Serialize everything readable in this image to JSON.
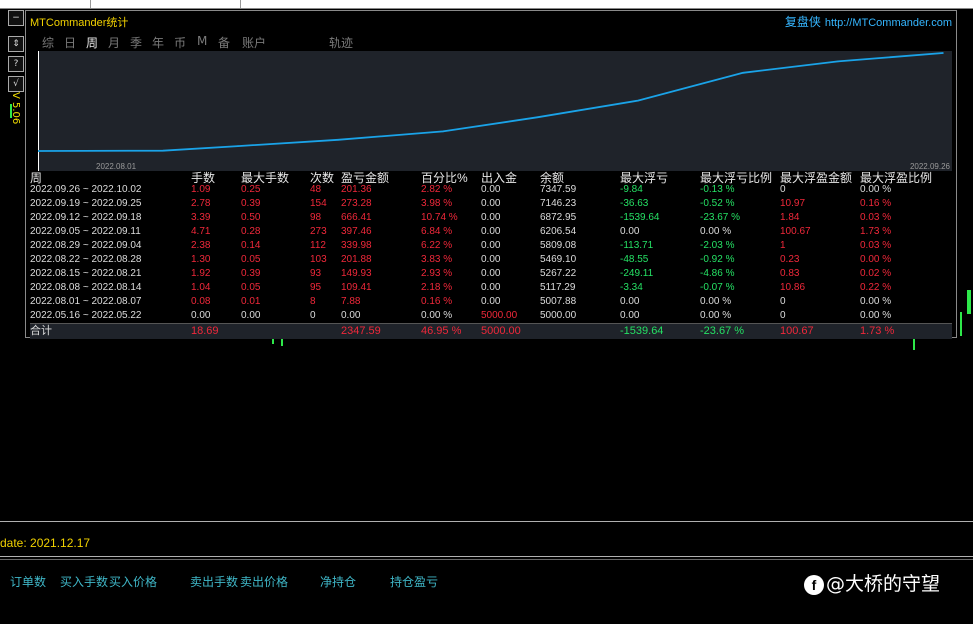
{
  "window": {
    "title": "MTCommander统计",
    "brand": "复盘侠",
    "url": "http://MTCommander.com"
  },
  "side_label": "V 5.06",
  "tabs": [
    {
      "label": "综",
      "active": false
    },
    {
      "label": "日",
      "active": false
    },
    {
      "label": "周",
      "active": true
    },
    {
      "label": "月",
      "active": false
    },
    {
      "label": "季",
      "active": false
    },
    {
      "label": "年",
      "active": false
    },
    {
      "label": "币",
      "active": false
    },
    {
      "label": "M",
      "active": false
    },
    {
      "label": "备",
      "active": false
    },
    {
      "label": "账户",
      "active": false
    },
    {
      "label": "轨迹",
      "active": false
    }
  ],
  "chart": {
    "x_start": "2022.08.01",
    "x_end": "2022.09.26",
    "line_color": "#1aa3e8"
  },
  "chart_data": {
    "type": "line",
    "title": "",
    "xlabel": "",
    "ylabel": "",
    "x": [
      "2022.05.16",
      "2022.08.01",
      "2022.08.08",
      "2022.08.15",
      "2022.08.22",
      "2022.08.29",
      "2022.09.05",
      "2022.09.12",
      "2022.09.19",
      "2022.09.26"
    ],
    "series": [
      {
        "values": [
          5000.0,
          5007.88,
          5117.29,
          5267.22,
          5469.1,
          5809.08,
          6206.54,
          6872.95,
          7146.23,
          7347.59
        ]
      }
    ]
  },
  "table": {
    "headers": [
      "周",
      "手数",
      "最大手数",
      "次数",
      "盈亏金额",
      "百分比%",
      "出入金",
      "余额",
      "最大浮亏",
      "最大浮亏比例",
      "最大浮盈金额",
      "最大浮盈比例"
    ],
    "rows": [
      [
        "2022.09.26 ~ 2022.10.02",
        "1.09",
        "0.25",
        "48",
        "201.36",
        "2.82 %",
        "0.00",
        "7347.59",
        "-9.84",
        "-0.13 %",
        "0",
        "0.00 %"
      ],
      [
        "2022.09.19 ~ 2022.09.25",
        "2.78",
        "0.39",
        "154",
        "273.28",
        "3.98 %",
        "0.00",
        "7146.23",
        "-36.63",
        "-0.52 %",
        "10.97",
        "0.16 %"
      ],
      [
        "2022.09.12 ~ 2022.09.18",
        "3.39",
        "0.50",
        "98",
        "666.41",
        "10.74 %",
        "0.00",
        "6872.95",
        "-1539.64",
        "-23.67 %",
        "1.84",
        "0.03 %"
      ],
      [
        "2022.09.05 ~ 2022.09.11",
        "4.71",
        "0.28",
        "273",
        "397.46",
        "6.84 %",
        "0.00",
        "6206.54",
        "0.00",
        "0.00 %",
        "100.67",
        "1.73 %"
      ],
      [
        "2022.08.29 ~ 2022.09.04",
        "2.38",
        "0.14",
        "112",
        "339.98",
        "6.22 %",
        "0.00",
        "5809.08",
        "-113.71",
        "-2.03 %",
        "1",
        "0.03 %"
      ],
      [
        "2022.08.22 ~ 2022.08.28",
        "1.30",
        "0.05",
        "103",
        "201.88",
        "3.83 %",
        "0.00",
        "5469.10",
        "-48.55",
        "-0.92 %",
        "0.23",
        "0.00 %"
      ],
      [
        "2022.08.15 ~ 2022.08.21",
        "1.92",
        "0.39",
        "93",
        "149.93",
        "2.93 %",
        "0.00",
        "5267.22",
        "-249.11",
        "-4.86 %",
        "0.83",
        "0.02 %"
      ],
      [
        "2022.08.08 ~ 2022.08.14",
        "1.04",
        "0.05",
        "95",
        "109.41",
        "2.18 %",
        "0.00",
        "5117.29",
        "-3.34",
        "-0.07 %",
        "10.86",
        "0.22 %"
      ],
      [
        "2022.08.01 ~ 2022.08.07",
        "0.08",
        "0.01",
        "8",
        "7.88",
        "0.16 %",
        "0.00",
        "5007.88",
        "0.00",
        "0.00 %",
        "0",
        "0.00 %"
      ],
      [
        "2022.05.16 ~ 2022.05.22",
        "0.00",
        "0.00",
        "0",
        "0.00",
        "0.00 %",
        "5000.00",
        "5000.00",
        "0.00",
        "0.00 %",
        "0",
        "0.00 %"
      ]
    ],
    "row_colors": [
      [
        "w",
        "r",
        "r",
        "r",
        "r",
        "r",
        "w",
        "w",
        "g",
        "g",
        "w",
        "w"
      ],
      [
        "w",
        "r",
        "r",
        "r",
        "r",
        "r",
        "w",
        "w",
        "g",
        "g",
        "r",
        "r"
      ],
      [
        "w",
        "r",
        "r",
        "r",
        "r",
        "r",
        "w",
        "w",
        "g",
        "g",
        "r",
        "r"
      ],
      [
        "w",
        "r",
        "r",
        "r",
        "r",
        "r",
        "w",
        "w",
        "w",
        "w",
        "r",
        "r"
      ],
      [
        "w",
        "r",
        "r",
        "r",
        "r",
        "r",
        "w",
        "w",
        "g",
        "g",
        "r",
        "r"
      ],
      [
        "w",
        "r",
        "r",
        "r",
        "r",
        "r",
        "w",
        "w",
        "g",
        "g",
        "r",
        "r"
      ],
      [
        "w",
        "r",
        "r",
        "r",
        "r",
        "r",
        "w",
        "w",
        "g",
        "g",
        "r",
        "r"
      ],
      [
        "w",
        "r",
        "r",
        "r",
        "r",
        "r",
        "w",
        "w",
        "g",
        "g",
        "r",
        "r"
      ],
      [
        "w",
        "r",
        "r",
        "r",
        "r",
        "r",
        "w",
        "w",
        "w",
        "w",
        "w",
        "w"
      ],
      [
        "w",
        "w",
        "w",
        "w",
        "w",
        "w",
        "r",
        "w",
        "w",
        "w",
        "w",
        "w"
      ]
    ],
    "total": {
      "label": "合计",
      "lots": "18.69",
      "pnl": "2347.59",
      "pct": "46.95 %",
      "deposit": "5000.00",
      "max_dd": "-1539.64",
      "max_dd_pct": "-23.67 %",
      "max_fp": "100.67",
      "max_fp_pct": "1.73 %"
    }
  },
  "status": {
    "update_text": "date: 2021.12.17"
  },
  "bottom_nav": [
    "订单数",
    "买入手数",
    "买入价格",
    "卖出手数",
    "卖出价格",
    "净持仓",
    "持仓盈亏"
  ],
  "watermark": "@大桥的守望"
}
